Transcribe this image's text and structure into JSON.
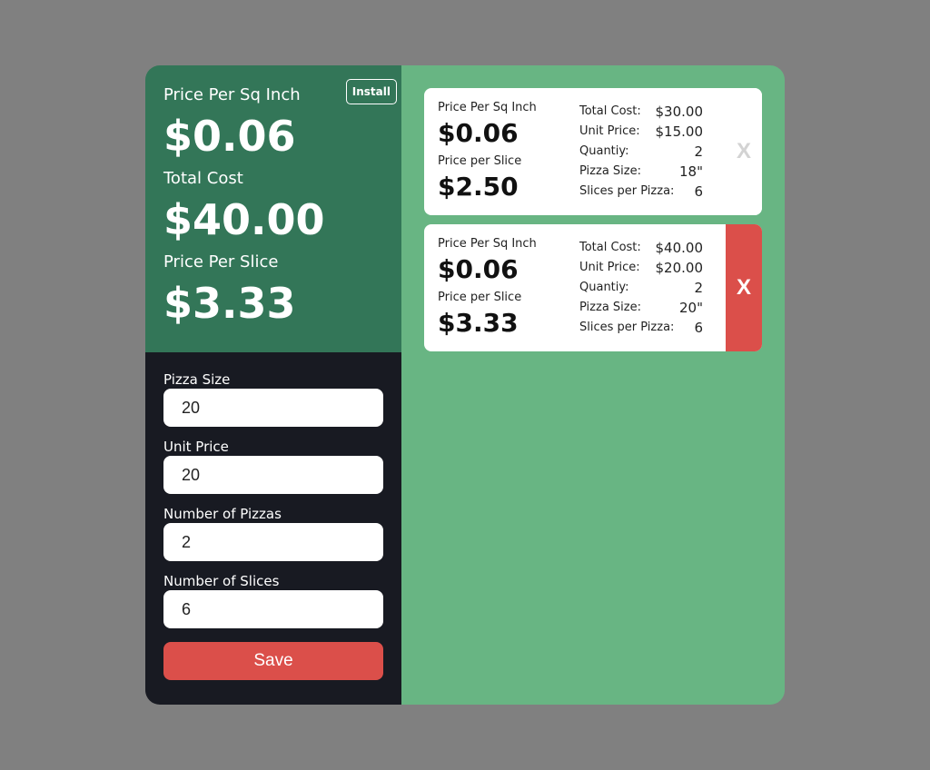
{
  "summary": {
    "price_sq_label": "Price Per Sq Inch",
    "price_sq_value": "$0.06",
    "total_cost_label": "Total Cost",
    "total_cost_value": "$40.00",
    "price_slice_label": "Price Per Slice",
    "price_slice_value": "$3.33",
    "install_label": "Install"
  },
  "form": {
    "pizza_size_label": "Pizza Size",
    "pizza_size_value": "20",
    "unit_price_label": "Unit Price",
    "unit_price_value": "20",
    "num_pizzas_label": "Number of Pizzas",
    "num_pizzas_value": "2",
    "num_slices_label": "Number of Slices",
    "num_slices_value": "6",
    "save_label": "Save"
  },
  "cards": [
    {
      "price_sq_label": "Price Per Sq Inch",
      "price_sq_value": "$0.06",
      "price_slice_label": "Price per Slice",
      "price_slice_value": "$2.50",
      "total_cost_label": "Total Cost:",
      "total_cost_value": "$30.00",
      "unit_price_label": "Unit Price:",
      "unit_price_value": "$15.00",
      "quantity_label": "Quantiy:",
      "quantity_value": "2",
      "pizza_size_label": "Pizza Size:",
      "pizza_size_value": "18\"",
      "slices_label": "Slices per Pizza:",
      "slices_value": "6",
      "delete_label": "X"
    },
    {
      "price_sq_label": "Price Per Sq Inch",
      "price_sq_value": "$0.06",
      "price_slice_label": "Price per Slice",
      "price_slice_value": "$3.33",
      "total_cost_label": "Total Cost:",
      "total_cost_value": "$40.00",
      "unit_price_label": "Unit Price:",
      "unit_price_value": "$20.00",
      "quantity_label": "Quantiy:",
      "quantity_value": "2",
      "pizza_size_label": "Pizza Size:",
      "pizza_size_value": "20\"",
      "slices_label": "Slices per Pizza:",
      "slices_value": "6",
      "delete_label": "X"
    }
  ],
  "colors": {
    "summary_bg": "#337658",
    "form_bg": "#181a22",
    "list_bg": "#68b583",
    "accent_red": "#db4f4a",
    "page_bg": "#808080"
  }
}
